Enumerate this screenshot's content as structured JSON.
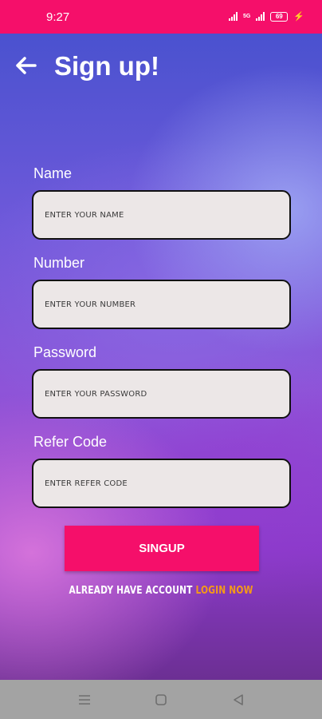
{
  "status_bar": {
    "time": "9:27",
    "network": "5G",
    "battery": "69"
  },
  "header": {
    "title": "Sign up!"
  },
  "form": {
    "fields": [
      {
        "label": "Name",
        "placeholder": "ENTER YOUR NAME"
      },
      {
        "label": "Number",
        "placeholder": "ENTER YOUR NUMBER"
      },
      {
        "label": "Password",
        "placeholder": "ENTER YOUR PASSWORD"
      },
      {
        "label": "Refer Code",
        "placeholder": "ENTER REFER CODE"
      }
    ],
    "submit_label": "SINGUP",
    "login_prompt": "ALREADY HAVE ACCOUNT",
    "login_link": "LOGIN NOW"
  },
  "colors": {
    "accent": "#f50f6a",
    "link": "#f59a17",
    "field_bg": "#ece7e7"
  },
  "icons": {
    "back": "arrow-left-icon",
    "nav_menu": "menu-icon",
    "nav_home": "square-icon",
    "nav_back": "triangle-back-icon"
  }
}
